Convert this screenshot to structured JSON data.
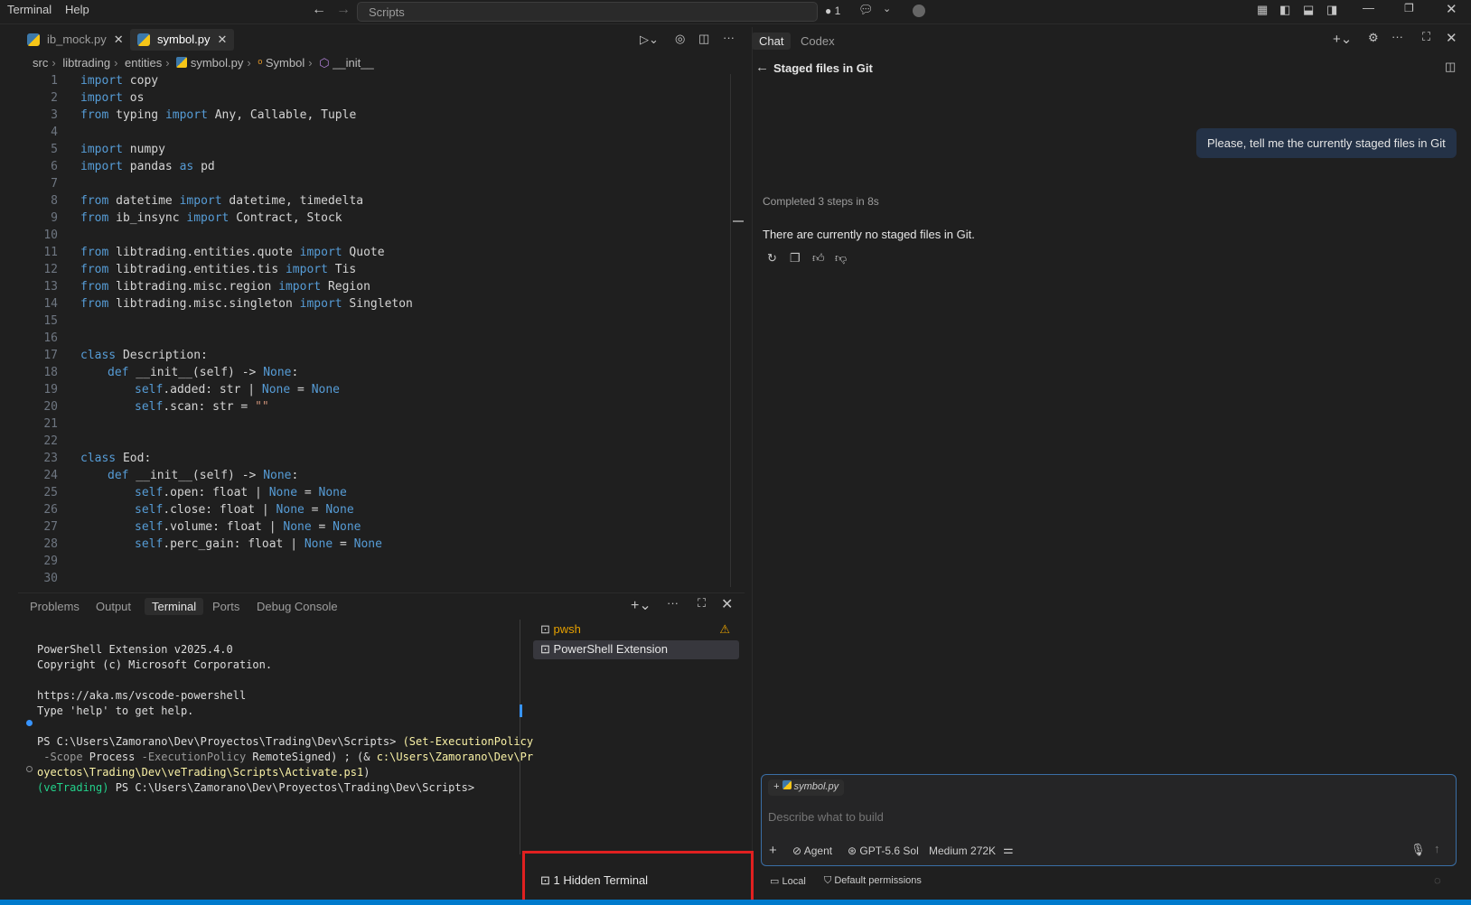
{
  "menu": {
    "terminal": "Terminal",
    "help": "Help"
  },
  "search": {
    "placeholder": "Scripts"
  },
  "titlebar": {
    "notifications": "1"
  },
  "editor": {
    "tabs": [
      {
        "label": "ib_mock.py"
      },
      {
        "label": "symbol.py"
      }
    ],
    "breadcrumb": [
      "src",
      "libtrading",
      "entities",
      "symbol.py",
      "Symbol",
      "__init__"
    ]
  },
  "code": {
    "lines": [
      "1",
      "2",
      "3",
      "4",
      "5",
      "6",
      "7",
      "8",
      "9",
      "10",
      "11",
      "12",
      "13",
      "14",
      "15",
      "16",
      "17",
      "18",
      "19",
      "20",
      "21",
      "22",
      "23",
      "24",
      "25",
      "26",
      "27",
      "28",
      "29",
      "30"
    ],
    "t": {
      "import": "import",
      "from": "from",
      "as": "as",
      "class": "class",
      "def": "def",
      "none": "None",
      "self": "self",
      "copy": " copy",
      "os": " os",
      "typing": " typing ",
      "anycall": " Any, Callable, Tuple",
      "numpy": " numpy",
      "pandas": " pandas ",
      "pd": " pd",
      "datetime": " datetime ",
      "dtd": " datetime, timedelta",
      "ibinsync": " ib_insync ",
      "cs": " Contract, Stock",
      "quote": " libtrading.entities.quote ",
      "quoteN": " Quote",
      "tis": " libtrading.entities.tis ",
      "tisN": " Tis",
      "region": " libtrading.misc.region ",
      "regionN": " Region",
      "single": " libtrading.misc.singleton ",
      "singleN": " Singleton",
      "desc": " Description:",
      "eod": " Eod:",
      "init": " __init__(self) -> ",
      "colon": ":",
      "added": ".added: str | ",
      "eqnone": " = ",
      "scan": ".scan: str = ",
      "emptystr": "\"\"",
      "open": ".open: float | ",
      "close": ".close: float | ",
      "volume": ".volume: float | ",
      "perc": ".perc_gain: float | "
    }
  },
  "chat": {
    "tabs": [
      "Chat",
      "Codex"
    ],
    "title": "Staged files in Git",
    "user_message": "Please, tell me the currently staged files in Git",
    "status": "Completed 3 steps in 8s",
    "reply": "There are currently no staged files in Git.",
    "attachment": "symbol.py",
    "input_placeholder": "Describe what to build",
    "mode": "Agent",
    "model": "GPT-5.6 Sol",
    "effort": "Medium 272K",
    "footer_local": "Local",
    "footer_permissions": "Default permissions"
  },
  "panel": {
    "tabs": [
      "Problems",
      "Output",
      "Terminal",
      "Ports",
      "Debug Console"
    ],
    "terminals": [
      "pwsh",
      "PowerShell Extension"
    ],
    "hidden": "1 Hidden Terminal",
    "term": {
      "l1": "PowerShell Extension v2025.4.0",
      "l2": "Copyright (c) Microsoft Corporation.",
      "l3": "https://aka.ms/vscode-powershell",
      "l4": "Type 'help' to get help.",
      "p1": "PS C:\\Users\\Zamorano\\Dev\\Proyectos\\Trading\\Dev\\Scripts> ",
      "c1": "(Set-ExecutionPolicy",
      "p2a": " -Scope ",
      "p2b": "Process",
      "p2c": " -ExecutionPolicy ",
      "p2d": "RemoteSigned",
      "p2e": ") ; (& ",
      "p2f": "c:\\Users\\Zamorano\\Dev\\Pr",
      "p3": "oyectos\\Trading\\Dev\\veTrading\\Scripts\\Activate.ps1",
      "p3e": ")",
      "venv": "(veTrading)",
      "p4": " PS C:\\Users\\Zamorano\\Dev\\Proyectos\\Trading\\Dev\\Scripts>"
    }
  },
  "colors": {
    "accent": "#3a6ea5",
    "highlight": "#e02020",
    "keyword": "#569cd6"
  }
}
